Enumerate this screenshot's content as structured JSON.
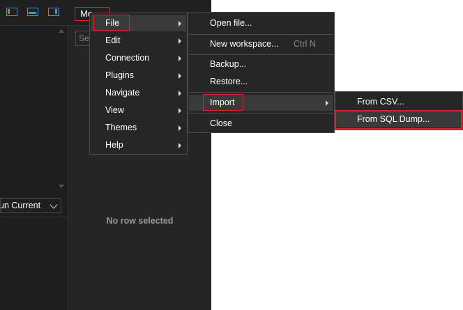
{
  "toolbar": {
    "menu_label": "Me",
    "icons": [
      "layout-left-icon",
      "layout-bottom-icon",
      "layout-right-icon"
    ]
  },
  "left_pane": {
    "run_select_value": "un Current"
  },
  "right_pane": {
    "search_placeholder": "Sea",
    "empty_text": "No row selected"
  },
  "main_menu": {
    "items": [
      {
        "label": "File"
      },
      {
        "label": "Edit"
      },
      {
        "label": "Connection"
      },
      {
        "label": "Plugins"
      },
      {
        "label": "Navigate"
      },
      {
        "label": "View"
      },
      {
        "label": "Themes"
      },
      {
        "label": "Help"
      }
    ]
  },
  "file_menu": {
    "items": [
      {
        "label": "Open file..."
      },
      {
        "label": "New workspace...",
        "shortcut": "Ctrl N"
      },
      {
        "label": "Backup..."
      },
      {
        "label": "Restore..."
      },
      {
        "label": "Import"
      },
      {
        "label": "Close"
      }
    ]
  },
  "import_menu": {
    "items": [
      {
        "label": "From CSV..."
      },
      {
        "label": "From SQL Dump..."
      }
    ]
  },
  "colors": {
    "accent": "#4a90d9",
    "highlight_border": "#d9232e",
    "menu_bg": "#262626",
    "menu_hover": "#3a3a3a"
  }
}
